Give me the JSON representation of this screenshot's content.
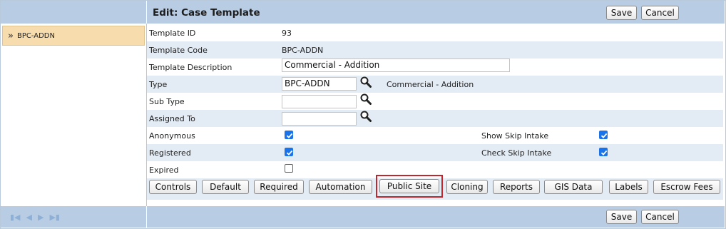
{
  "header": {
    "title": "Edit: Case Template",
    "save_label": "Save",
    "cancel_label": "Cancel"
  },
  "footer": {
    "save_label": "Save",
    "cancel_label": "Cancel"
  },
  "sidebar": {
    "items": [
      {
        "chevron": "»",
        "label": "BPC-ADDN"
      }
    ]
  },
  "pager": {
    "icons": [
      "first-page-icon",
      "prev-page-icon",
      "next-page-icon",
      "last-page-icon"
    ]
  },
  "form": {
    "template_id": {
      "label": "Template ID",
      "value": "93"
    },
    "template_code": {
      "label": "Template Code",
      "value": "BPC-ADDN"
    },
    "template_description": {
      "label": "Template Description",
      "value": "Commercial - Addition"
    },
    "type": {
      "label": "Type",
      "value": "BPC-ADDN",
      "description": "Commercial - Addition"
    },
    "sub_type": {
      "label": "Sub Type",
      "value": ""
    },
    "assigned_to": {
      "label": "Assigned To",
      "value": ""
    },
    "anonymous": {
      "label": "Anonymous",
      "checked": true
    },
    "registered": {
      "label": "Registered",
      "checked": true
    },
    "expired": {
      "label": "Expired",
      "checked": false
    },
    "show_skip_intake": {
      "label": "Show Skip Intake",
      "checked": true
    },
    "check_skip_intake": {
      "label": "Check Skip Intake",
      "checked": true
    }
  },
  "tabs": [
    "Controls",
    "Default",
    "Required",
    "Automation",
    "Public Site",
    "Cloning",
    "Reports",
    "GIS Data",
    "Labels",
    "Escrow Fees"
  ],
  "colors": {
    "header_bg": "#b8cde3",
    "selected_item_bg": "#f7dcae",
    "alt_row_bg": "#e3ebf4",
    "checkbox_on": "#1a73e8",
    "highlight": "#c0262d"
  }
}
